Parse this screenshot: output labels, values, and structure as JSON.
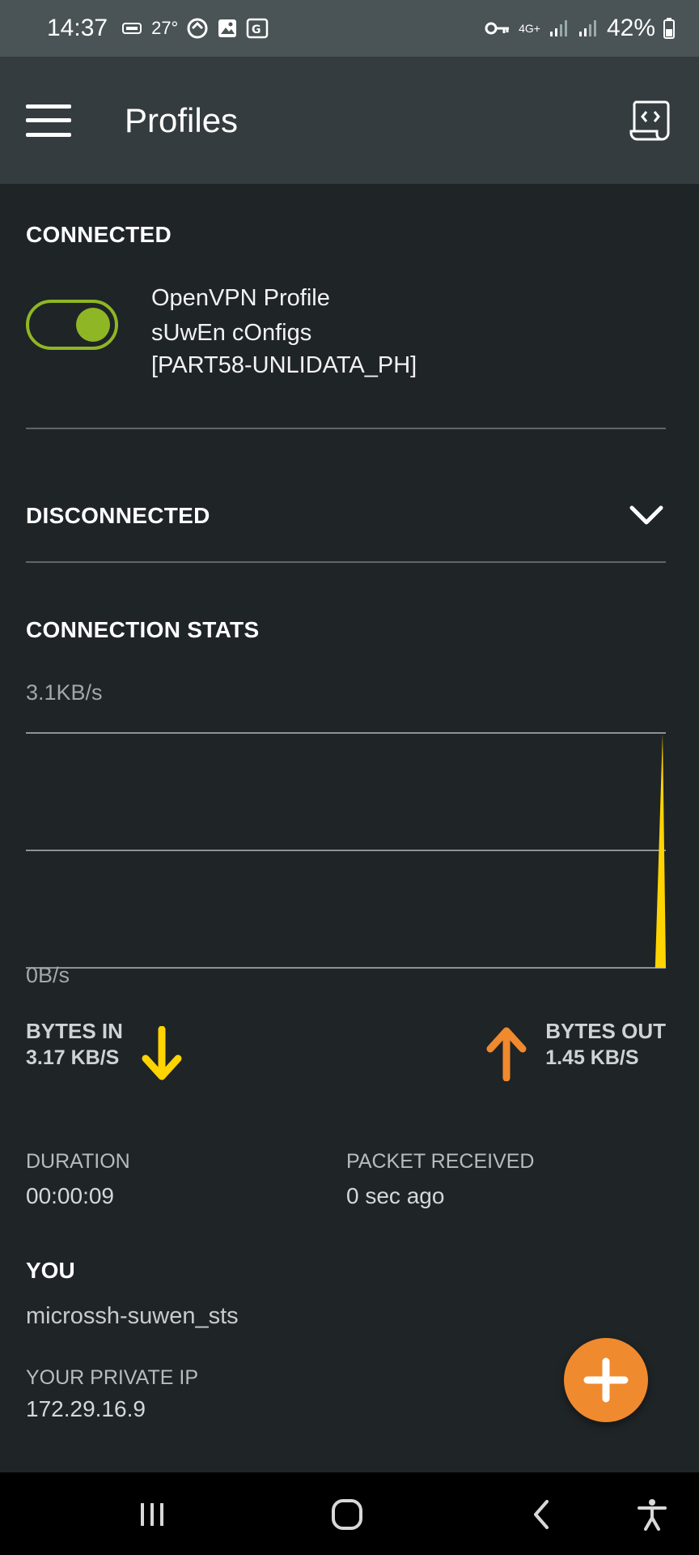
{
  "status_bar": {
    "time": "14:37",
    "temperature": "27°",
    "battery": "42%",
    "network": "4G+"
  },
  "app_bar": {
    "title": "Profiles"
  },
  "sections": {
    "connected": "CONNECTED",
    "disconnected": "DISCONNECTED",
    "stats": "CONNECTION STATS",
    "you": "YOU"
  },
  "profile": {
    "type": "OpenVPN Profile",
    "name_line1": "sUwEn cOnfigs",
    "name_line2": "[PART58-UNLIDATA_PH]",
    "enabled": true
  },
  "chart_data": {
    "type": "area",
    "y_max_label": "3.1KB/s",
    "y_min_label": "0B/s",
    "ylim": [
      0,
      3.1
    ],
    "y_unit": "KB/s",
    "gridlines": 3,
    "values": [
      0,
      0,
      0,
      0,
      0,
      0,
      0,
      0,
      0,
      0,
      0,
      0,
      0,
      0,
      0,
      0,
      0,
      0,
      0,
      0,
      0,
      0,
      0,
      0,
      0,
      0,
      0,
      0,
      0,
      0,
      0,
      0,
      0,
      0,
      0,
      0,
      0,
      0,
      0,
      0,
      0,
      0,
      0,
      0,
      0,
      0,
      0,
      0,
      0,
      0,
      0,
      0,
      0,
      0,
      0,
      0,
      0,
      0,
      0,
      3.1
    ],
    "color": "#ffd400"
  },
  "bytes_in": {
    "label": "BYTES IN",
    "value": "3.17 KB/S",
    "color": "#ffd400"
  },
  "bytes_out": {
    "label": "BYTES OUT",
    "value": "1.45 KB/S",
    "color": "#f08a2e"
  },
  "duration": {
    "label": "DURATION",
    "value": "00:00:09"
  },
  "packet": {
    "label": "PACKET RECEIVED",
    "value": "0 sec ago"
  },
  "you": {
    "name": "microssh-suwen_sts",
    "ip_label": "YOUR PRIVATE IP",
    "ip_value": "172.29.16.9"
  },
  "colors": {
    "accent": "#8fb624",
    "fab": "#f08a2e",
    "background": "#1f2427",
    "app_bar": "#353c3f"
  }
}
